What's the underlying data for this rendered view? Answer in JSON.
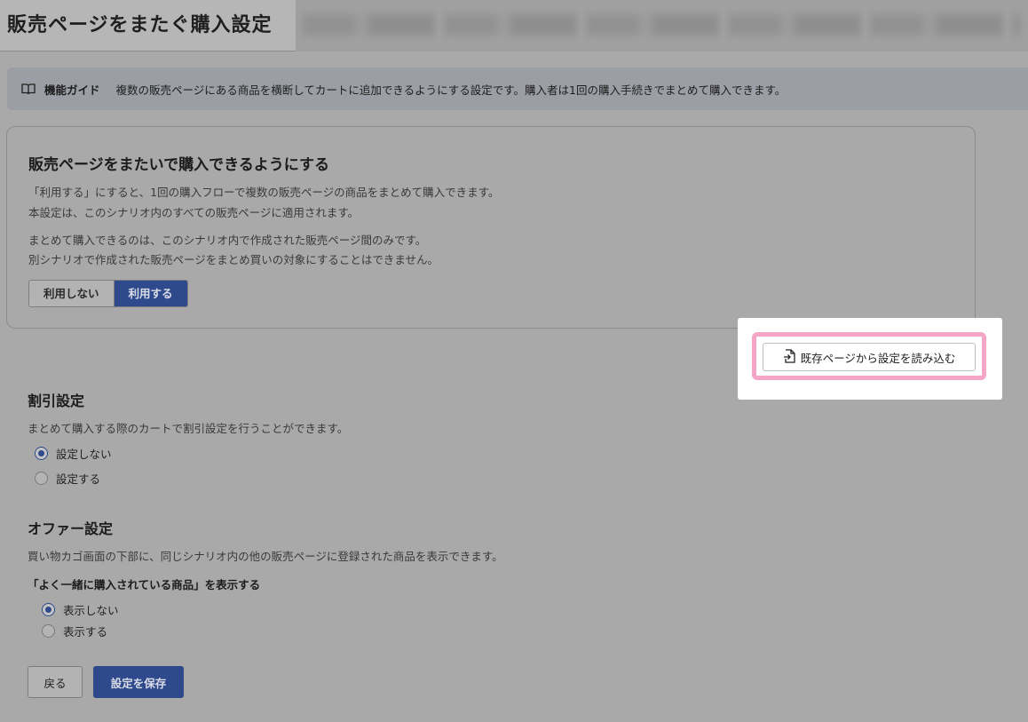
{
  "page": {
    "title": "販売ページをまたぐ購入設定"
  },
  "guide": {
    "label": "機能ガイド",
    "text": "複数の販売ページにある商品を横断してカートに追加できるようにする設定です。購入者は1回の購入手続きでまとめて購入できます。"
  },
  "cross_purchase": {
    "heading": "販売ページをまたいで購入できるようにする",
    "desc_line1": "「利用する」にすると、1回の購入フローで複数の販売ページの商品をまとめて購入できます。",
    "desc_line2": "本設定は、このシナリオ内のすべての販売ページに適用されます。",
    "desc_line3": "まとめて購入できるのは、このシナリオ内で作成された販売ページ間のみです。",
    "desc_line4": "別シナリオで作成された販売ページをまとめ買いの対象にすることはできません。",
    "option_off": "利用しない",
    "option_on": "利用する",
    "selected": "利用する"
  },
  "load_button": {
    "label": "既存ページから設定を読み込む",
    "icon": "file-import-icon"
  },
  "discount": {
    "heading": "割引設定",
    "desc": "まとめて購入する際のカートで割引設定を行うことができます。",
    "options": [
      "設定しない",
      "設定する"
    ],
    "selected": "設定しない"
  },
  "offer": {
    "heading": "オファー設定",
    "desc": "買い物カゴ画面の下部に、同じシナリオ内の他の販売ページに登録された商品を表示できます。",
    "sub_label": "「よく一緒に購入されている商品」を表示する",
    "options": [
      "表示しない",
      "表示する"
    ],
    "selected": "表示しない"
  },
  "footer": {
    "back_label": "戻る",
    "save_label": "設定を保存"
  },
  "colors": {
    "accent": "#2e4a8c",
    "highlight": "#f5a6c7",
    "overlay": "#a9a9a9"
  }
}
